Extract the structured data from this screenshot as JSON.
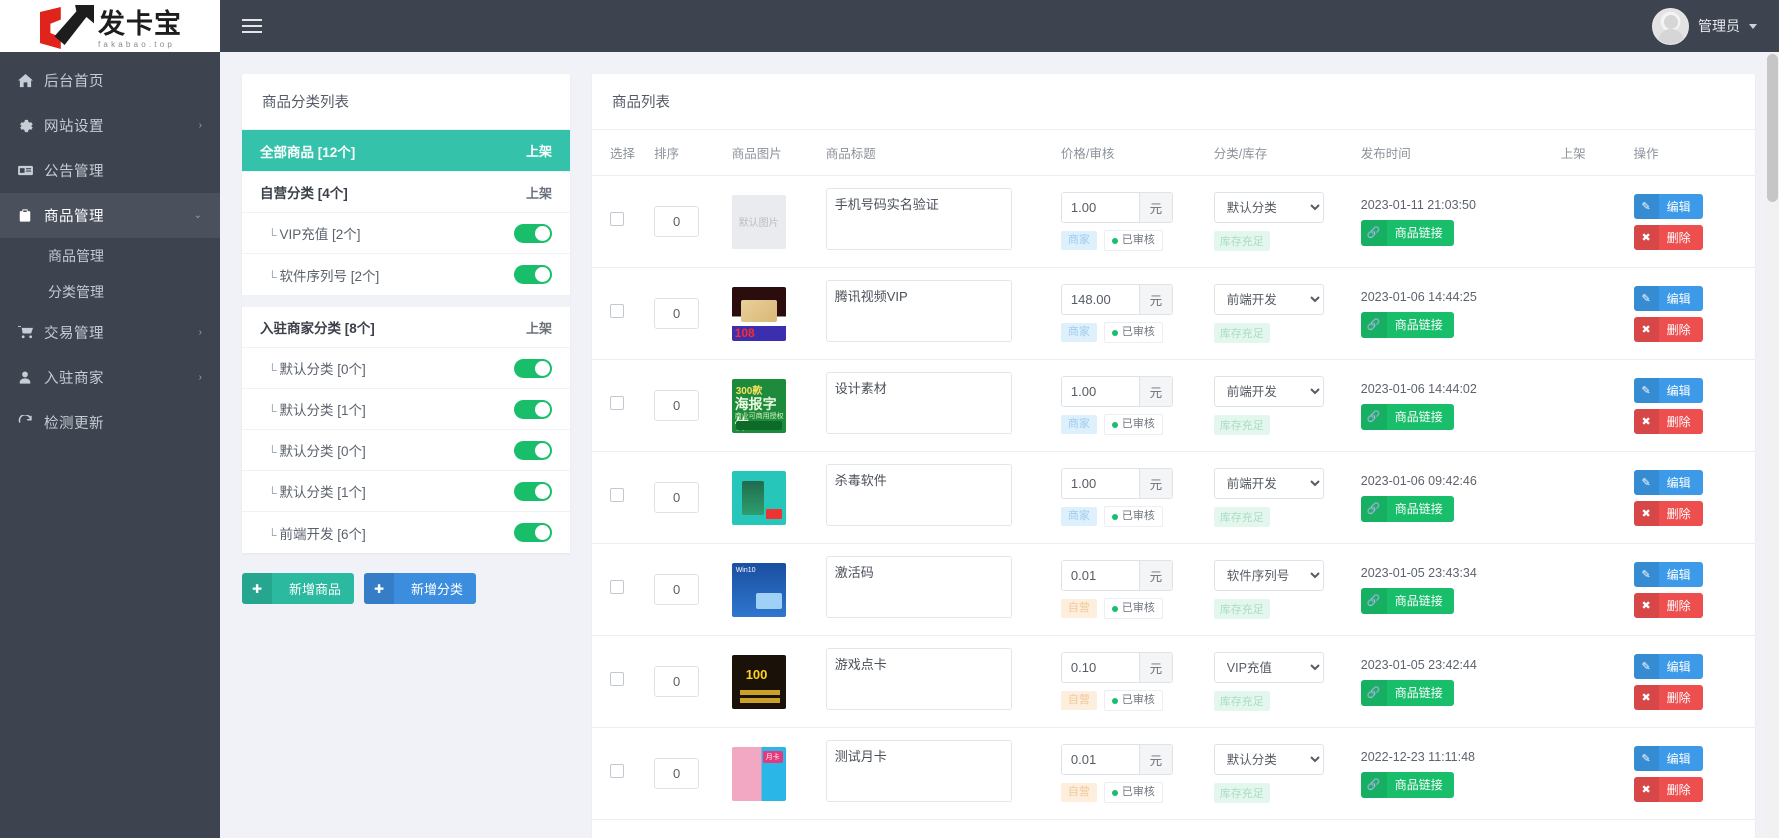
{
  "brand": {
    "cn": "发卡宝",
    "en": "fakabao.top"
  },
  "topbar": {
    "user_name": "管理员",
    "menu_icon": "hamburger-icon",
    "caret": "chevron-down-icon"
  },
  "sidebar": {
    "items": [
      {
        "label": "后台首页",
        "icon": "home-icon",
        "arrow": "",
        "active": false
      },
      {
        "label": "网站设置",
        "icon": "gear-icon",
        "arrow": "›",
        "active": false
      },
      {
        "label": "公告管理",
        "icon": "megaphone-icon",
        "arrow": "",
        "active": false
      },
      {
        "label": "商品管理",
        "icon": "bag-icon",
        "arrow": "⌄",
        "active": true
      },
      {
        "label": "交易管理",
        "icon": "cart-icon",
        "arrow": "›",
        "active": false
      },
      {
        "label": "入驻商家",
        "icon": "user-icon",
        "arrow": "›",
        "active": false
      },
      {
        "label": "检测更新",
        "icon": "refresh-icon",
        "arrow": "",
        "active": false
      }
    ],
    "sub_items": [
      {
        "label": "商品管理"
      },
      {
        "label": "分类管理"
      }
    ]
  },
  "category_panel": {
    "title": "商品分类列表",
    "shelf_label": "上架",
    "groups": [
      {
        "rows": [
          {
            "label": "全部商品 [12个]",
            "type": "selected",
            "right": "上架"
          },
          {
            "label": "自营分类 [4个]",
            "type": "group",
            "right": "上架"
          },
          {
            "label": "VIP充值 [2个]",
            "type": "child",
            "right": "switch"
          },
          {
            "label": "软件序列号 [2个]",
            "type": "child",
            "right": "switch"
          }
        ]
      },
      {
        "rows": [
          {
            "label": "入驻商家分类 [8个]",
            "type": "group",
            "right": "上架"
          },
          {
            "label": "默认分类 [0个]",
            "type": "child",
            "right": "switch"
          },
          {
            "label": "默认分类 [1个]",
            "type": "child",
            "right": "switch"
          },
          {
            "label": "默认分类 [0个]",
            "type": "child",
            "right": "switch"
          },
          {
            "label": "默认分类 [1个]",
            "type": "child",
            "right": "switch"
          },
          {
            "label": "前端开发 [6个]",
            "type": "child",
            "right": "switch"
          }
        ]
      }
    ],
    "buttons": [
      {
        "label": "新增商品",
        "icon": "plus-circle-icon",
        "color": "#2bb9a0"
      },
      {
        "label": "新增分类",
        "icon": "plus-circle-icon",
        "color": "#3c8dde"
      }
    ]
  },
  "product_panel": {
    "title": "商品列表",
    "columns": [
      "选择",
      "排序",
      "商品图片",
      "商品标题",
      "价格/审核",
      "分类/库存",
      "发布时间",
      "上架",
      "操作"
    ],
    "unit": "元",
    "audit_label": "已审核",
    "stock_label": "库存充足",
    "link_label": "商品链接",
    "edit_label": "编辑",
    "delete_label": "删除",
    "placeholder_image_label": "默认图片",
    "rows": [
      {
        "checked": false,
        "sort": "0",
        "thumb": "placeholder",
        "title": "手机号码实名验证",
        "price": "1.00",
        "owner": "商家",
        "owner_type": "merchant",
        "audit": "已审核",
        "category": "默认分类",
        "stock": "库存充足",
        "time": "2023-01-11 21:03:50",
        "on_shelf": true
      },
      {
        "checked": false,
        "sort": "0",
        "thumb": "t2",
        "title": "腾讯视频VIP",
        "price": "148.00",
        "owner": "商家",
        "owner_type": "merchant",
        "audit": "已审核",
        "category": "前端开发",
        "stock": "库存充足",
        "time": "2023-01-06 14:44:25",
        "on_shelf": true
      },
      {
        "checked": false,
        "sort": "0",
        "thumb": "t3",
        "title": "设计素材",
        "price": "1.00",
        "owner": "商家",
        "owner_type": "merchant",
        "audit": "已审核",
        "category": "前端开发",
        "stock": "库存充足",
        "time": "2023-01-06 14:44:02",
        "on_shelf": true
      },
      {
        "checked": false,
        "sort": "0",
        "thumb": "t4",
        "title": "杀毒软件",
        "price": "1.00",
        "owner": "商家",
        "owner_type": "merchant",
        "audit": "已审核",
        "category": "前端开发",
        "stock": "库存充足",
        "time": "2023-01-06 09:42:46",
        "on_shelf": true
      },
      {
        "checked": false,
        "sort": "0",
        "thumb": "t5",
        "title": "激活码",
        "price": "0.01",
        "owner": "自营",
        "owner_type": "self",
        "audit": "已审核",
        "category": "软件序列号",
        "stock": "库存充足",
        "time": "2023-01-05 23:43:34",
        "on_shelf": true
      },
      {
        "checked": false,
        "sort": "0",
        "thumb": "t6",
        "title": "游戏点卡",
        "price": "0.10",
        "owner": "自营",
        "owner_type": "self",
        "audit": "已审核",
        "category": "VIP充值",
        "stock": "库存充足",
        "time": "2023-01-05 23:42:44",
        "on_shelf": true
      },
      {
        "checked": false,
        "sort": "0",
        "thumb": "t7",
        "title": "测试月卡",
        "price": "0.01",
        "owner": "自营",
        "owner_type": "self",
        "audit": "已审核",
        "category": "默认分类",
        "stock": "库存充足",
        "time": "2022-12-23 11:11:48",
        "on_shelf": true
      }
    ],
    "category_options": [
      "默认分类",
      "前端开发",
      "软件序列号",
      "VIP充值"
    ]
  },
  "colors": {
    "sidebar": "#3d4450",
    "accent_teal": "#34c2ab",
    "green": "#19be6b",
    "blue": "#3c9ae8",
    "red": "#ed4f4f"
  }
}
